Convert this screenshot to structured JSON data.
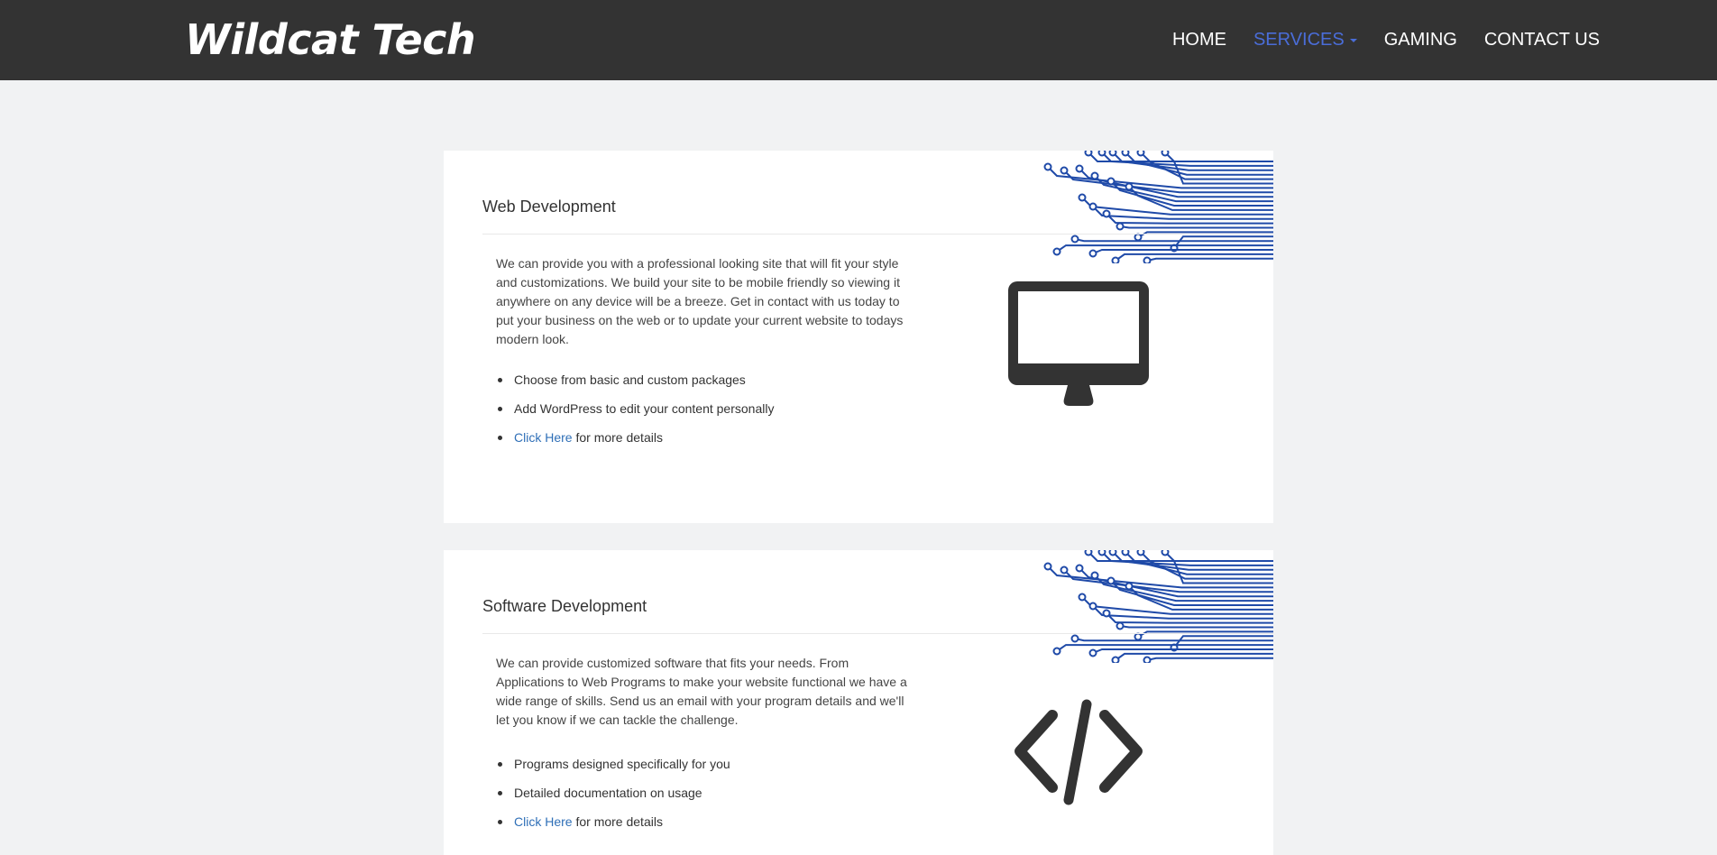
{
  "navbar": {
    "brand": "Wildcat Tech",
    "items": [
      {
        "label": "HOME"
      },
      {
        "label": "SERVICES"
      },
      {
        "label": "GAMING"
      },
      {
        "label": "CONTACT US"
      }
    ]
  },
  "sections": [
    {
      "title": "Web Development",
      "description": "We can provide you with a professional looking site that will fit your style and customizations. We build your site to be mobile friendly so viewing it anywhere on any device will be a breeze. Get in contact with us today to put your business on the web or to update your current website to todays modern look.",
      "bullets": [
        "Choose from basic and custom packages",
        "Add WordPress to edit your content personally"
      ],
      "link_text": "Click Here",
      "link_suffix": " for more details",
      "icon": "monitor-icon"
    },
    {
      "title": "Software Development",
      "description": "We can provide customized software that fits your needs. From Applications to Web Programs to make your website functional we have a wide range of skills. Send us an email with your program details and we'll let you know if we can tackle the challenge.",
      "bullets": [
        "Programs designed specifically for you",
        "Detailed documentation on usage"
      ],
      "link_text": "Click Here",
      "link_suffix": " for more details",
      "icon": "code-icon"
    }
  ],
  "colors": {
    "navbar_bg": "#333333",
    "active_nav": "#4a6dd8",
    "circuit": "#1f4aa8",
    "link": "#2f6fb7",
    "page_bg": "#f1f2f3"
  }
}
